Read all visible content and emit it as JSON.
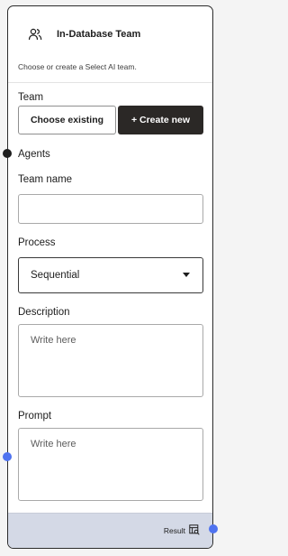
{
  "header": {
    "title": "In-Database Team",
    "icon": "users-icon"
  },
  "subtitle": "Choose or create a Select AI team.",
  "team": {
    "label": "Team",
    "choose_existing_label": "Choose existing",
    "create_new_label": "+ Create new"
  },
  "agents_label": "Agents",
  "team_name": {
    "label": "Team name",
    "value": ""
  },
  "process": {
    "label": "Process",
    "selected": "Sequential"
  },
  "description": {
    "label": "Description",
    "placeholder": "Write here"
  },
  "prompt": {
    "label": "Prompt",
    "placeholder": "Write here"
  },
  "footer": {
    "result_label": "Result",
    "result_icon": "table-search-icon"
  },
  "colors": {
    "handle_dark": "#1d1d1d",
    "handle_blue": "#4f73f0",
    "footer_bg": "#d4d9e6",
    "dark_button": "#2b2826"
  }
}
